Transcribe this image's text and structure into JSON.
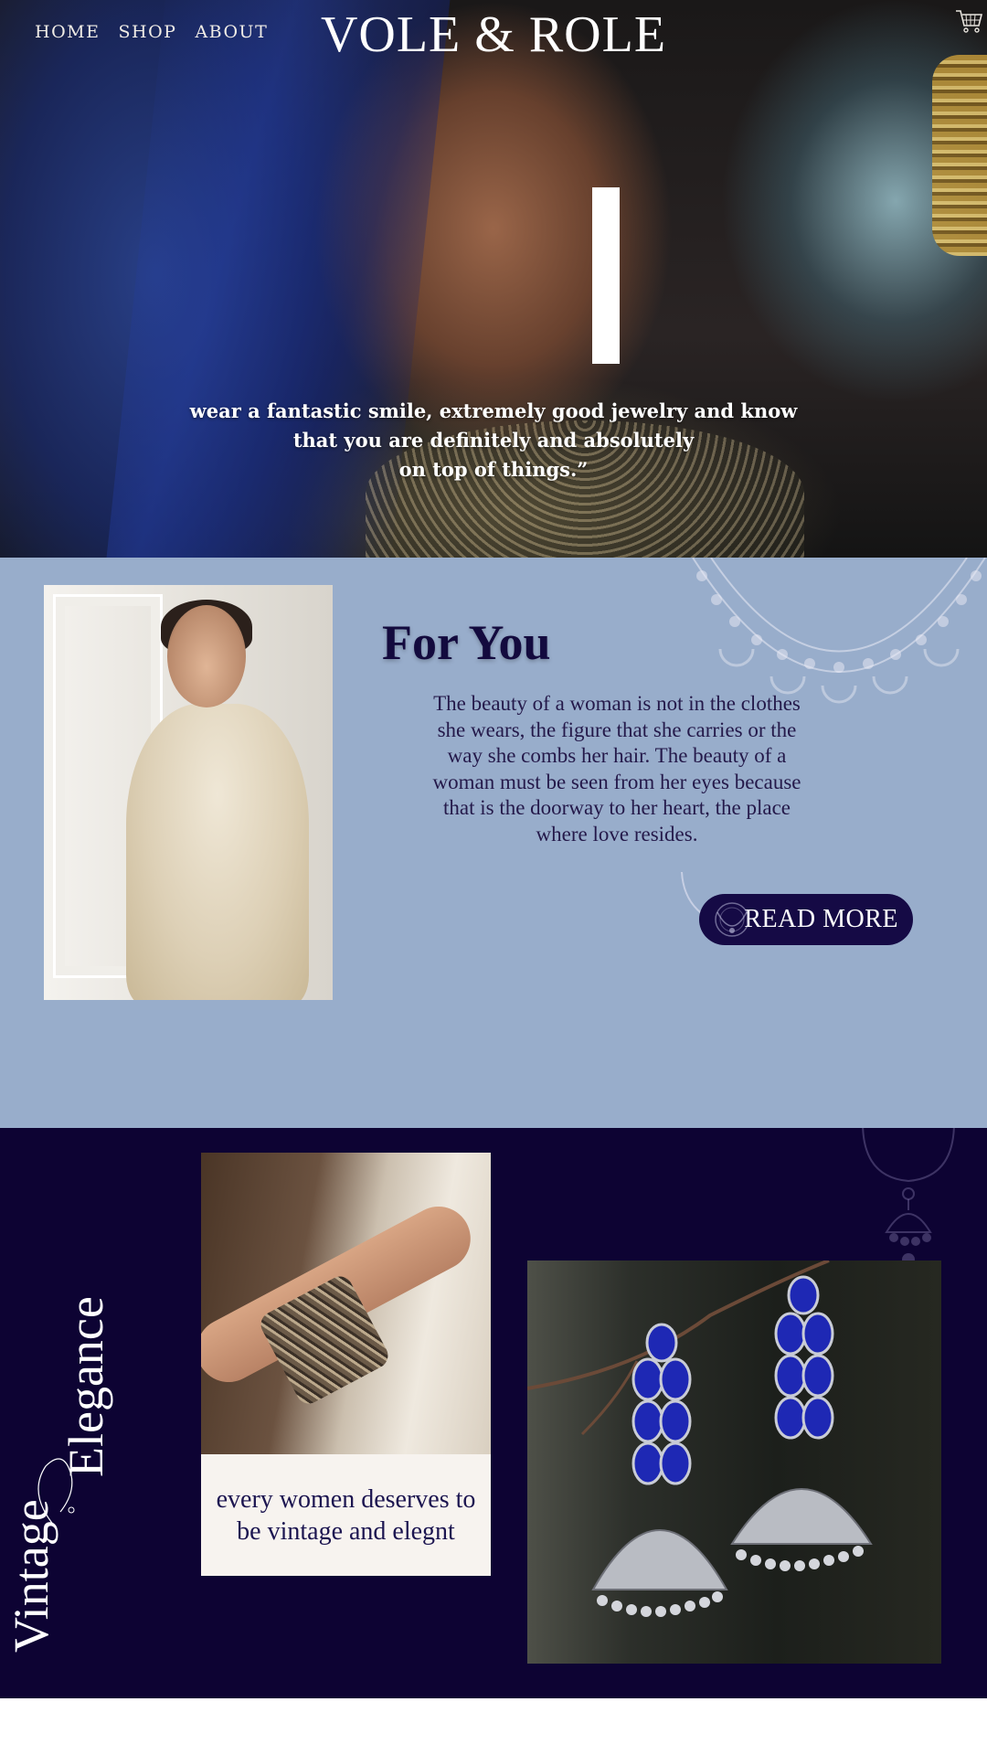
{
  "nav": {
    "items": [
      "HOME",
      "SHOP",
      "ABOUT"
    ]
  },
  "brand": {
    "name": "VOLE & ROLE"
  },
  "hero": {
    "quote_lines": [
      "wear a fantastic smile, extremely good jewelry and know",
      "that you are definitely  and absolutely",
      "on top of things.”"
    ]
  },
  "for_you": {
    "title": "For You",
    "body": "The beauty of a woman is not in the clothes she wears, the figure that she carries or the way she combs her hair. The beauty of a woman must be seen from her eyes because that is the doorway to her heart, the place where love resides.",
    "button_label": "READ MORE"
  },
  "vintage": {
    "title_word_1": "Vintage",
    "title_word_2": "Elegance",
    "caption": "every women deserves to be vintage and elegnt"
  },
  "colors": {
    "hero_text": "#ffffff",
    "for_you_bg": "#98adcb",
    "for_you_title": "#130a3e",
    "button_bg": "#150a45",
    "vintage_bg": "#0d0333",
    "caption_bg": "#f7f3ef"
  },
  "icons": {
    "cart": "cart-icon",
    "button_ornament": "necklace-ornament-icon"
  }
}
